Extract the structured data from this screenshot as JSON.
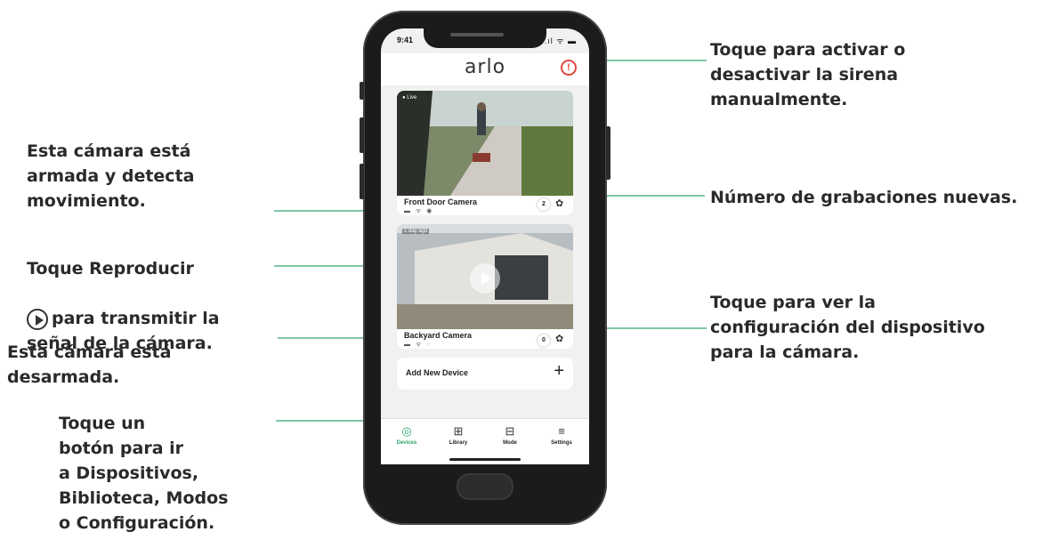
{
  "callouts": {
    "siren": "Toque para activar o\ndesactivar la sirena\nmanualmente.",
    "armed": "Esta cámara está\narmada y detecta\nmovimiento.",
    "play_prefix": "Toque Reproducir",
    "play_suffix": "para transmitir la\nseñal de la cámara.",
    "recordings": "Número de grabaciones nuevas.",
    "settings": "Toque para ver la\nconfiguración del dispositivo\npara la cámara.",
    "disarmed": "Esta cámara está\ndesarmada.",
    "tabs": "Toque un\nbotón para ir\na Dispositivos,\nBiblioteca, Modos\no Configuración."
  },
  "phone": {
    "time": "9:41",
    "status_icons": "..ıl ᯤ ▬",
    "logo": "arlo",
    "siren_icon": "siren-icon",
    "accent_color": "#2aa66a",
    "callout_line_color": "#7fc6a4",
    "cameras": [
      {
        "name": "Front Door Camera",
        "tag": "● Live",
        "new_recordings": "2",
        "icons": "▬ ᯤ ◉"
      },
      {
        "name": "Backyard Camera",
        "tag": "1 day ago",
        "new_recordings": "0",
        "icons": "▬ ᯤ ◌"
      }
    ],
    "add_device": "Add New Device",
    "tabs": [
      {
        "label": "Devices",
        "icon": "devices-icon",
        "glyph": "◎"
      },
      {
        "label": "Library",
        "icon": "library-icon",
        "glyph": "⊞"
      },
      {
        "label": "Mode",
        "icon": "mode-icon",
        "glyph": "⊟"
      },
      {
        "label": "Settings",
        "icon": "settings-icon",
        "glyph": "≡"
      }
    ]
  }
}
